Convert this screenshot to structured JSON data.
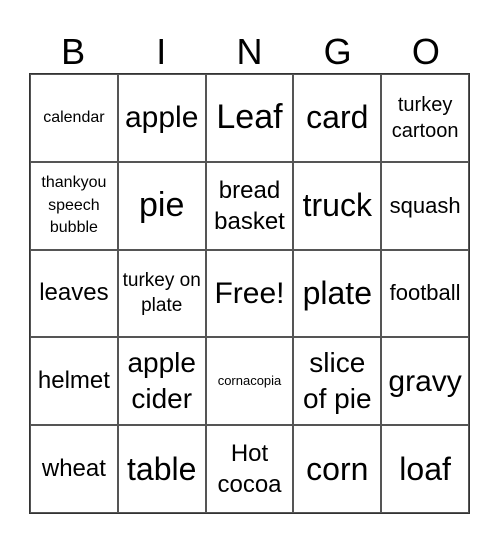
{
  "header": [
    "B",
    "I",
    "N",
    "G",
    "O"
  ],
  "rows": [
    [
      "calendar",
      "apple",
      "Leaf",
      "card",
      "turkey cartoon"
    ],
    [
      "thankyou speech bubble",
      "pie",
      "bread basket",
      "truck",
      "squash"
    ],
    [
      "leaves",
      "turkey on plate",
      "Free!",
      "plate",
      "football"
    ],
    [
      "helmet",
      "apple cider",
      "cornacopia",
      "slice of pie",
      "gravy"
    ],
    [
      "wheat",
      "table",
      "Hot cocoa",
      "corn",
      "loaf"
    ]
  ]
}
